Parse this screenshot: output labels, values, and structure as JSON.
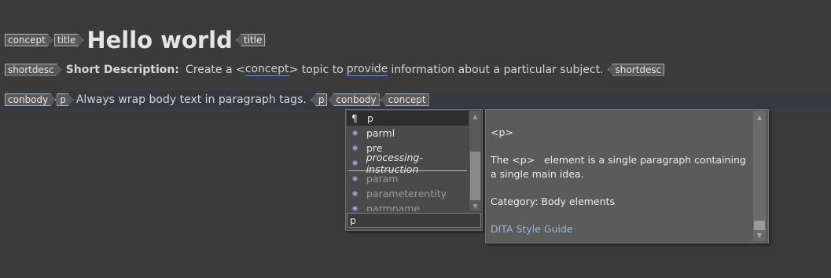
{
  "line1": {
    "tag_concept": "concept",
    "tag_title": "title",
    "heading": "Hello world",
    "tag_title_end": "title"
  },
  "line2": {
    "tag_shortdesc": "shortdesc",
    "label": "Short Description:",
    "text_before": "Create a <",
    "link_concept": "concept",
    "text_mid": "> topic to",
    "link_provide": "provide",
    "text_after": "information about a particular subject.",
    "tag_shortdesc_end": "shortdesc"
  },
  "line3": {
    "tag_conbody": "conbody",
    "tag_p": "p",
    "text": "Always wrap body text in paragraph tags.",
    "tag_p_end": "p",
    "tag_conbody_end": "conbody",
    "tag_concept_end": "concept"
  },
  "completion": {
    "items": [
      {
        "label": "p",
        "icon": "paragraph-icon"
      },
      {
        "label": "parml",
        "icon": "element-bullet-icon"
      },
      {
        "label": "pre",
        "icon": "element-bullet-icon"
      },
      {
        "label": "processing-instruction",
        "icon": "element-bullet-icon"
      },
      {
        "label": "param",
        "icon": "element-bullet-icon"
      },
      {
        "label": "parameterentity",
        "icon": "element-bullet-icon"
      },
      {
        "label": "parmname",
        "icon": "element-bullet-icon"
      }
    ],
    "filter_value": "p"
  },
  "doc": {
    "tag_name": "<p>",
    "description_1": "The <p>",
    "description_2": "element is a single paragraph containing a single main idea.",
    "category": "Category: Body elements",
    "guide_link": "DITA Style Guide"
  },
  "colors": {
    "background": "#3b3b3b",
    "tag_fill": "#585858",
    "link_underline": "#6b8fd8",
    "guide_link": "#8fb8ea"
  }
}
